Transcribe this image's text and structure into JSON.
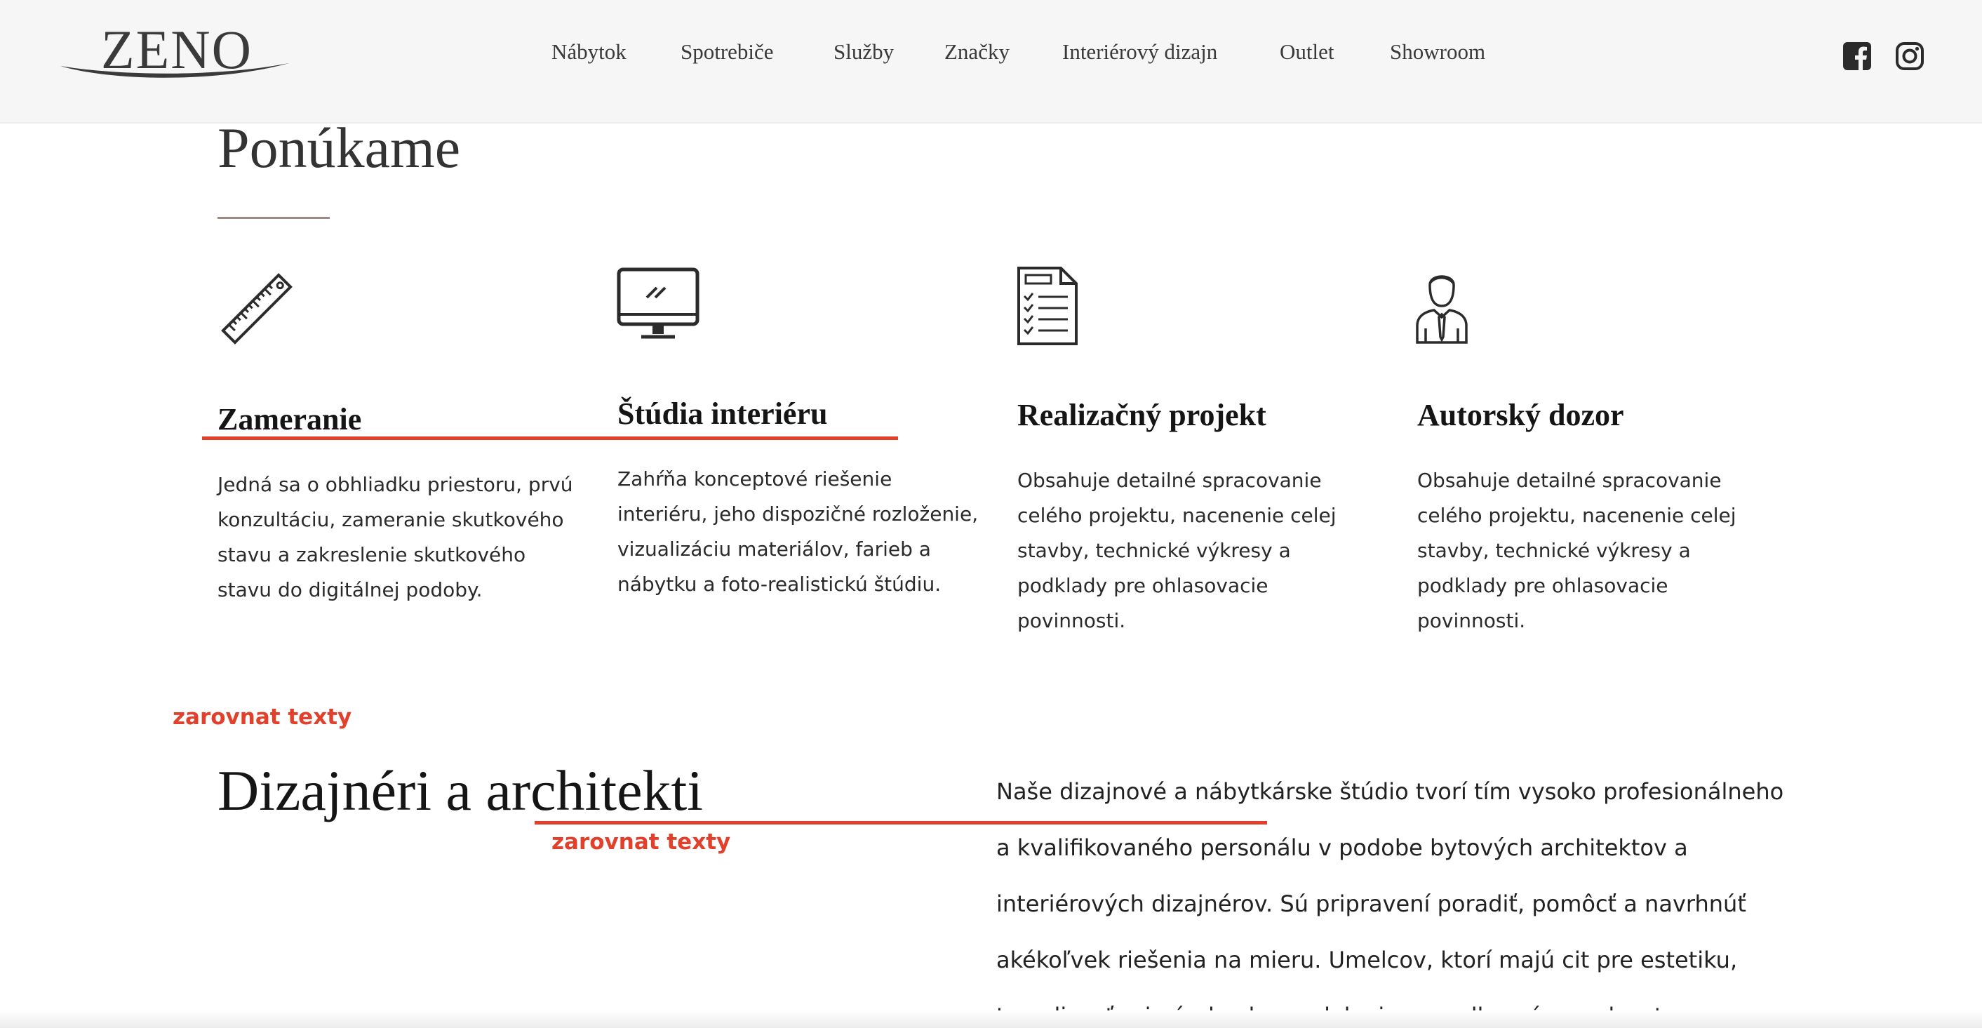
{
  "header": {
    "logo_text": "ZENO",
    "nav": [
      "Nábytok",
      "Spotrebiče",
      "Služby",
      "Značky",
      "Interiérový dizajn",
      "Outlet",
      "Showroom"
    ],
    "social": [
      "facebook-icon",
      "instagram-icon"
    ]
  },
  "offer": {
    "title": "Ponúkame",
    "services": [
      {
        "icon": "ruler-icon",
        "title": "Zameranie",
        "lines": [
          "Jedná sa o obhliadku priestoru, prvú",
          "konzultáciu, zameranie skutkového",
          "stavu a zakreslenie skutkového",
          "stavu do digitálnej podoby."
        ]
      },
      {
        "icon": "monitor-icon",
        "title": "Štúdia interiéru",
        "lines": [
          "Zahŕňa konceptové riešenie",
          "interiéru, jeho dispozičné rozloženie,",
          "vizualizáciu materiálov, farieb a",
          "nábytku a foto-realistickú štúdiu."
        ]
      },
      {
        "icon": "checklist-document-icon",
        "title": "Realizačný projekt",
        "lines": [
          "Obsahuje detailné spracovanie",
          "celého projektu, nacenenie celej",
          "stavby, technické výkresy a",
          "podklady pre ohlasovacie",
          "povinnosti."
        ]
      },
      {
        "icon": "person-tie-icon",
        "title": "Autorský dozor",
        "lines": [
          "Obsahuje detailné spracovanie",
          "celého projektu, nacenenie celej",
          "stavby, technické výkresy a",
          "podklady pre ohlasovacie",
          "povinnosti."
        ]
      }
    ]
  },
  "annotations": [
    "zarovnat texty",
    "zarovnat texty"
  ],
  "team": {
    "title": "Dizajnéri a architekti",
    "lines": [
      "Naše dizajnové a nábytkárske štúdio tvorí tím vysoko profesionálneho",
      "a kvalifikovaného personálu v podobe bytových architektov a",
      "interiérových dizajnérov. Sú pripravení poradiť, pomôcť a navrhnúť",
      "akékoľvek riešenia na mieru. Umelcov, ktorí majú cit pre estetiku,",
      "trpezlivosť pri návrhoch a vzdelanie pre odborné poradenstvo,"
    ]
  },
  "colors": {
    "annotation": "#e2402b",
    "header_bg": "#f6f6f6",
    "title_rule": "#9c8a85"
  }
}
